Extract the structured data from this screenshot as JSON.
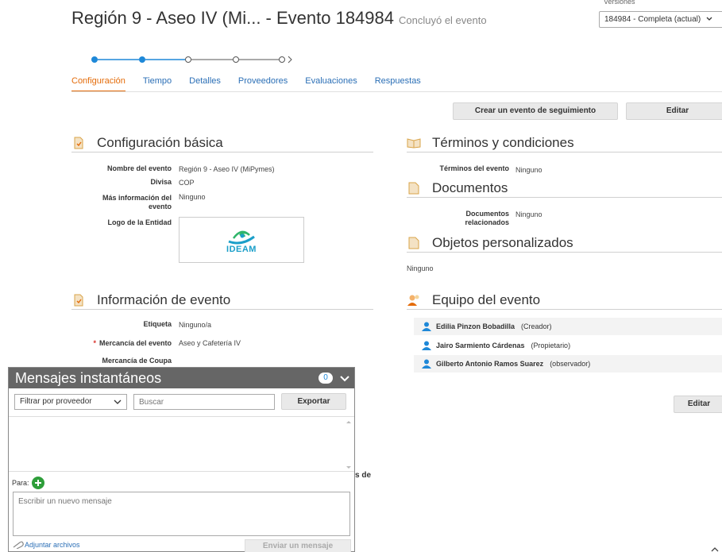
{
  "header": {
    "title": "Región 9 - Aseo IV (Mi... - Evento 184984",
    "status": "Concluyó el evento",
    "version_label": "Versiones",
    "version_selected": "184984 - Completa (actual)"
  },
  "tabs": [
    {
      "label": "Configuración",
      "active": true
    },
    {
      "label": "Tiempo"
    },
    {
      "label": "Detalles"
    },
    {
      "label": "Proveedores"
    },
    {
      "label": "Evaluaciones"
    },
    {
      "label": "Respuestas"
    }
  ],
  "progress": {
    "completed_steps": 2,
    "total_steps": 5
  },
  "actions": {
    "follow_up": "Crear un evento de seguimiento",
    "edit": "Editar",
    "edit_bottom": "Editar"
  },
  "basic_config": {
    "title": "Configuración básica",
    "event_name_label": "Nombre del evento",
    "event_name_value": "Región 9 - Aseo IV (MiPymes)",
    "currency_label": "Divisa",
    "currency_value": "COP",
    "more_info_label": "Más información del evento",
    "more_info_value": "Ninguno",
    "logo_label": "Logo de la Entidad",
    "logo_text": "IDEAM"
  },
  "event_info": {
    "title": "Información de evento",
    "tag_label": "Etiqueta",
    "tag_value": "Ninguno/a",
    "commodity_label": "Mercancía del evento",
    "commodity_value": "Aseo y Cafetería IV",
    "coupa_label": "Mercancía de Coupa",
    "partial_text": "s de"
  },
  "terms": {
    "title": "Términos y condiciones",
    "label": "Términos del evento",
    "value": "Ninguno"
  },
  "documents": {
    "title": "Documentos",
    "label": "Documentos relacionados",
    "value": "Ninguno"
  },
  "custom_objects": {
    "title": "Objetos personalizados",
    "value": "Ninguno"
  },
  "team": {
    "title": "Equipo del evento",
    "members": [
      {
        "name": "Edilia Pinzon Bobadilla",
        "role": "(Creador)"
      },
      {
        "name": "Jairo Sarmiento Cárdenas",
        "role": "(Propietario)"
      },
      {
        "name": "Gilberto Antonio Ramos Suarez",
        "role": "(observador)"
      }
    ]
  },
  "chat": {
    "title": "Mensajes instantáneos",
    "count": "0",
    "filter": "Filtrar por proveedor",
    "search_placeholder": "Buscar",
    "export": "Exportar",
    "to_label": "Para:",
    "compose_placeholder": "Escribir un nuevo mensaje",
    "attach": "Adjuntar archivos",
    "send": "Enviar un mensaje"
  },
  "colors": {
    "accent": "#e46c0a",
    "link": "#2b6fb6",
    "step_done": "#1e88d8",
    "chat_header": "#666666",
    "add_icon": "#2e9e3a"
  }
}
